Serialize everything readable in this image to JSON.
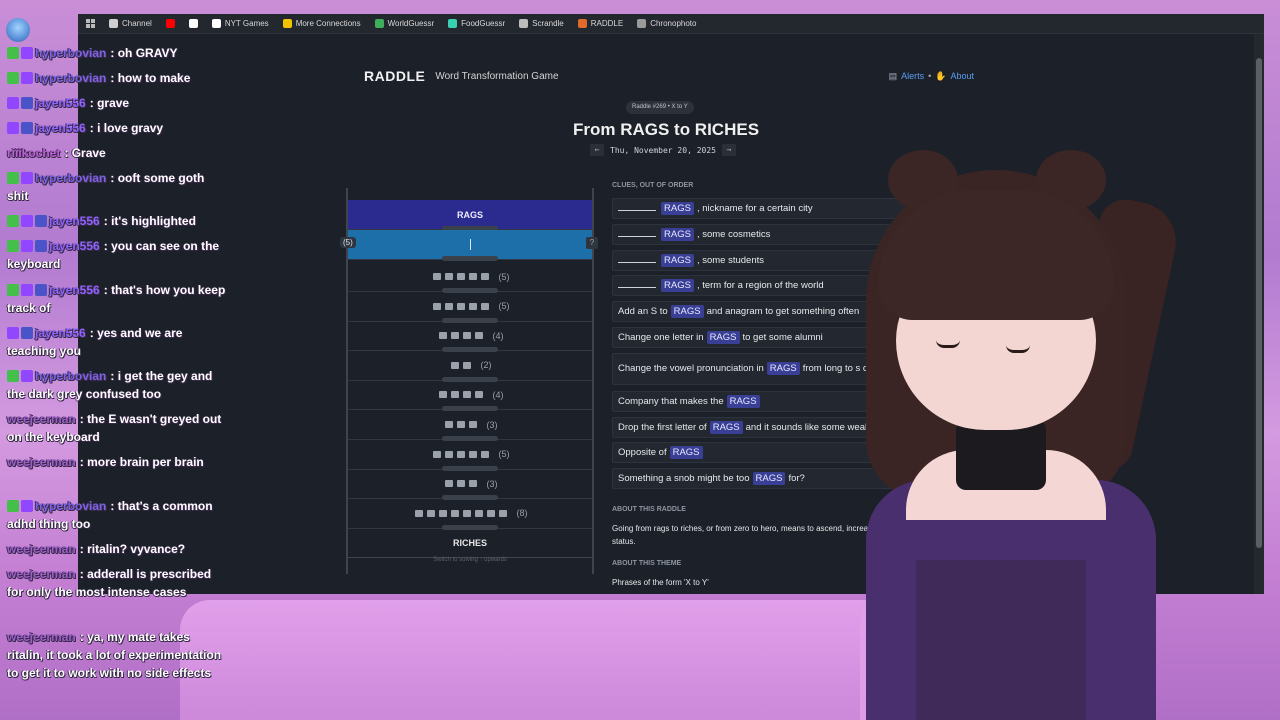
{
  "browser": {
    "bookmarks": [
      {
        "label": "Channel",
        "color": "#cfcfcf"
      },
      {
        "label": "",
        "color": "#ff0000"
      },
      {
        "label": "",
        "color": "#ffffff"
      },
      {
        "label": "NYT Games",
        "color": "#ffffff"
      },
      {
        "label": "More Connections",
        "color": "#f2c300"
      },
      {
        "label": "WorldGuessr",
        "color": "#3fae5a"
      },
      {
        "label": "FoodGuessr",
        "color": "#3ad0b3"
      },
      {
        "label": "Scrandle",
        "color": "#bcbcbc"
      },
      {
        "label": "RADDLE",
        "color": "#e06a2b"
      },
      {
        "label": "Chronophoto",
        "color": "#9a9a9a"
      }
    ]
  },
  "raddle": {
    "logo": "RADDLE",
    "tagline": "Word Transformation Game",
    "nav_alerts": "Alerts",
    "nav_sep": "•",
    "nav_about": "About",
    "badge": "Raddle #269 • X to Y",
    "title": "From RAGS to RICHES",
    "date": "Thu, November 20, 2025",
    "prev": "←",
    "next": "→",
    "start_word": "RAGS",
    "end_word": "RICHES",
    "active_len": "(5)",
    "hint": "?",
    "steps": [
      {
        "letters": 5,
        "count": "(5)"
      },
      {
        "letters": 5,
        "count": "(5)"
      },
      {
        "letters": 4,
        "count": "(4)"
      },
      {
        "letters": 2,
        "count": "(2)"
      },
      {
        "letters": 4,
        "count": "(4)"
      },
      {
        "letters": 3,
        "count": "(3)"
      },
      {
        "letters": 5,
        "count": "(5)"
      },
      {
        "letters": 3,
        "count": "(3)"
      },
      {
        "letters": 8,
        "count": "(8)"
      }
    ],
    "switch_text": "Switch to solving ↑ upwards",
    "clues_heading": "CLUES, OUT OF ORDER",
    "clues": [
      {
        "pre": "",
        "blank": true,
        "kw": "RAGS",
        "post": ", nickname for a certain city"
      },
      {
        "pre": "",
        "blank": true,
        "kw": "RAGS",
        "post": ", some cosmetics"
      },
      {
        "pre": "",
        "blank": true,
        "kw": "RAGS",
        "post": ", some students"
      },
      {
        "pre": "",
        "blank": true,
        "kw": "RAGS",
        "post": ", term for a region of the world"
      },
      {
        "pre": "Add an S to",
        "blank": false,
        "kw": "RAGS",
        "post": "and anagram to get something often"
      },
      {
        "pre": "Change one letter in",
        "blank": false,
        "kw": "RAGS",
        "post": "to get some alumni"
      },
      {
        "pre": "Change the vowel pronunciation in",
        "blank": false,
        "kw": "RAGS",
        "post": "from long to s computer"
      },
      {
        "pre": "Company that makes the",
        "blank": false,
        "kw": "RAGS",
        "post": ""
      },
      {
        "pre": "Drop the first letter of",
        "blank": false,
        "kw": "RAGS",
        "post": "and it sounds like some wealth"
      },
      {
        "pre": "Opposite of",
        "blank": false,
        "kw": "RAGS",
        "post": ""
      },
      {
        "pre": "Something a snob might be too",
        "blank": false,
        "kw": "RAGS",
        "post": "for?"
      }
    ],
    "about_heading": "ABOUT THIS RADDLE",
    "about_text": "Going from rags to riches, or from zero to hero, means to ascend, increasing your wealth or your status.",
    "theme_heading": "ABOUT THIS THEME",
    "theme_text": "Phrases of the form 'X to Y'"
  },
  "chat": [
    {
      "user": "hyperbovian",
      "text": "oh GRAVY",
      "badges": [
        "green",
        "prime"
      ]
    },
    {
      "user": "hyperbovian",
      "text": "how to make",
      "badges": [
        "green",
        "prime"
      ]
    },
    {
      "user": "jayen556",
      "text": "grave",
      "badges": [
        "prime",
        "sub"
      ]
    },
    {
      "user": "jayen556",
      "text": "i love gravy",
      "badges": [
        "prime",
        "sub"
      ]
    },
    {
      "user": "riiikochet",
      "text": "Grave",
      "badges": []
    },
    {
      "user": "hyperbovian",
      "text": "ooft some goth shit",
      "badges": [
        "green",
        "prime"
      ]
    },
    {
      "user": "jayen556",
      "text": "it's highlighted",
      "badges": [
        "green",
        "prime",
        "sub"
      ]
    },
    {
      "user": "jayen556",
      "text": "you can see on the keyboard",
      "badges": [
        "green",
        "prime",
        "sub"
      ]
    },
    {
      "user": "jayen556",
      "text": "that's how you keep track of",
      "badges": [
        "green",
        "prime",
        "sub"
      ]
    },
    {
      "user": "jayen556",
      "text": "yes and we are teaching you",
      "badges": [
        "prime",
        "sub"
      ]
    },
    {
      "user": "hyperbovian",
      "text": "i get the gey and the dark grey confused too",
      "badges": [
        "green",
        "prime"
      ]
    },
    {
      "user": "weejeerman",
      "text": "the E wasn't greyed out on the keyboard",
      "badges": []
    },
    {
      "user": "weejeerman",
      "text": "more brain per brain",
      "badges": []
    },
    {
      "user": "hyperbovian",
      "text": "that's a common adhd thing too",
      "badges": [
        "green",
        "prime"
      ]
    },
    {
      "user": "weejeerman",
      "text": "ritalin? vyvance?",
      "badges": []
    },
    {
      "user": "weejeerman",
      "text": "adderall is prescribed for only the most intense cases",
      "badges": []
    },
    {
      "user": "weejeerman",
      "text": "ya, my mate takes ritalin, it took a lot of experimentation to get it to work with no side effects",
      "badges": []
    }
  ]
}
